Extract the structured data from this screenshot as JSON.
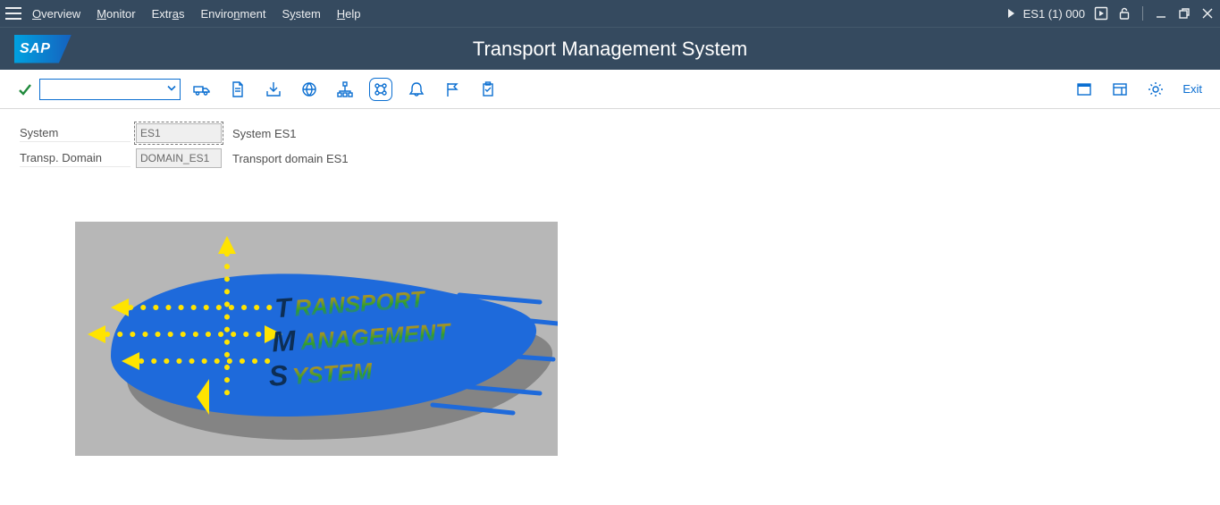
{
  "menubar": {
    "items": [
      {
        "pre": "",
        "u": "O",
        "post": "verview"
      },
      {
        "pre": "",
        "u": "M",
        "post": "onitor"
      },
      {
        "pre": "Extr",
        "u": "a",
        "post": "s"
      },
      {
        "pre": "Enviro",
        "u": "n",
        "post": "ment"
      },
      {
        "pre": "S",
        "u": "y",
        "post": "stem"
      },
      {
        "pre": "",
        "u": "H",
        "post": "elp"
      }
    ],
    "system_label": "ES1 (1) 000"
  },
  "title": "Transport Management System",
  "sap_logo_text": "SAP",
  "toolbar": {
    "cmd_value": "",
    "exit_label": "Exit"
  },
  "fields": {
    "system_label": "System",
    "system_value": "ES1",
    "system_desc": "System ES1",
    "domain_label": "Transp. Domain",
    "domain_value": "DOMAIN_ES1",
    "domain_desc": "Transport domain ES1"
  },
  "graphic": {
    "line1": "TRANSPORT",
    "line2": "MANAGEMENT",
    "line3": "SYSTEM"
  }
}
